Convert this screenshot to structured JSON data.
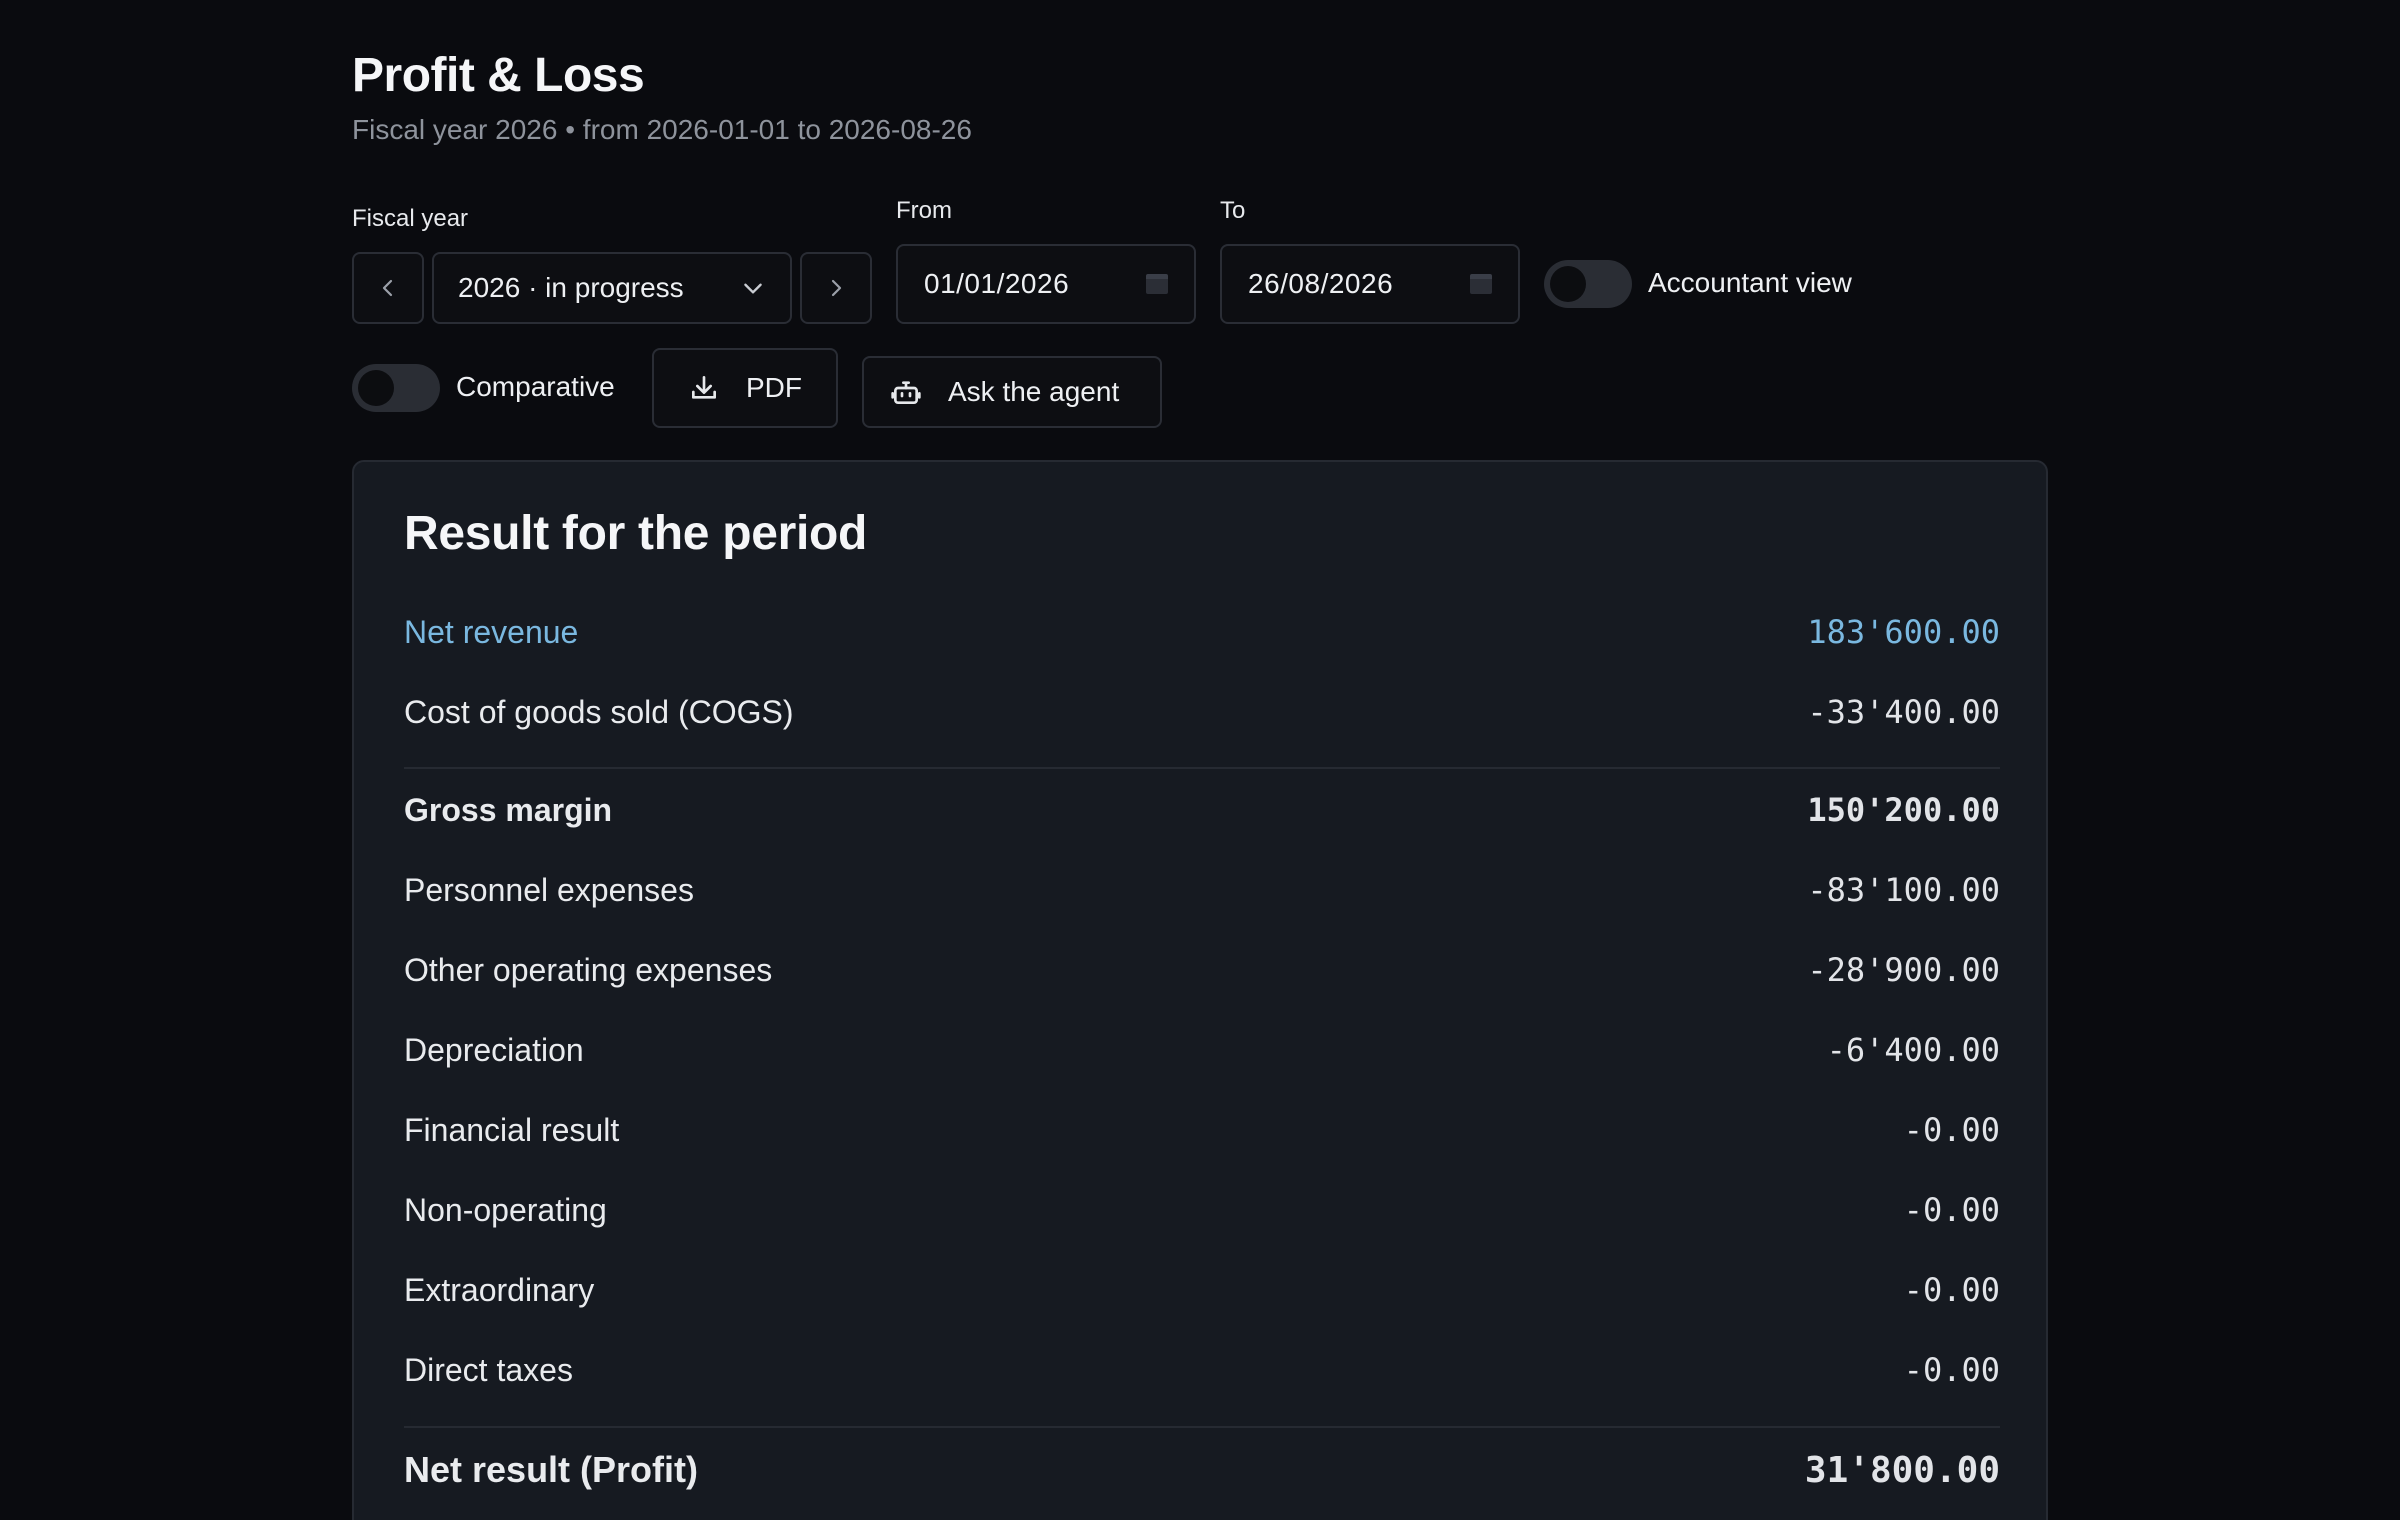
{
  "header": {
    "title": "Profit & Loss",
    "subtitle": "Fiscal year 2026 • from 2026-01-01 to 2026-08-26"
  },
  "filters": {
    "fiscal_year_label": "Fiscal year",
    "fiscal_year_value": "2026 · in progress",
    "from_label": "From",
    "from_value": "01/01/2026",
    "to_label": "To",
    "to_value": "26/08/2026",
    "accountant_view_label": "Accountant view",
    "accountant_view_on": false,
    "comparative_label": "Comparative",
    "comparative_on": false
  },
  "actions": {
    "pdf_label": "PDF",
    "agent_label": "Ask the agent"
  },
  "result": {
    "title": "Result for the period",
    "rows": [
      {
        "label": "Net revenue",
        "value": "183'600.00"
      },
      {
        "label": "Cost of goods sold (COGS)",
        "value": "-33'400.00"
      },
      {
        "label": "Gross margin",
        "value": "150'200.00"
      },
      {
        "label": "Personnel expenses",
        "value": "-83'100.00"
      },
      {
        "label": "Other operating expenses",
        "value": "-28'900.00"
      },
      {
        "label": "Depreciation",
        "value": "-6'400.00"
      },
      {
        "label": "Financial result",
        "value": "-0.00"
      },
      {
        "label": "Non-operating",
        "value": "-0.00"
      },
      {
        "label": "Extraordinary",
        "value": "-0.00"
      },
      {
        "label": "Direct taxes",
        "value": "-0.00"
      },
      {
        "label": "Net result (Profit)",
        "value": "31'800.00"
      }
    ]
  },
  "colors": {
    "background": "#0a0b0f",
    "card": "#161a21",
    "accent": "#7ab8e0",
    "muted_text": "#8e939c"
  },
  "icons": {
    "prev": "chevron-left-icon",
    "next": "chevron-right-icon",
    "dropdown": "chevron-down-icon",
    "calendar": "calendar-icon",
    "download": "download-icon",
    "agent": "robot-icon"
  }
}
